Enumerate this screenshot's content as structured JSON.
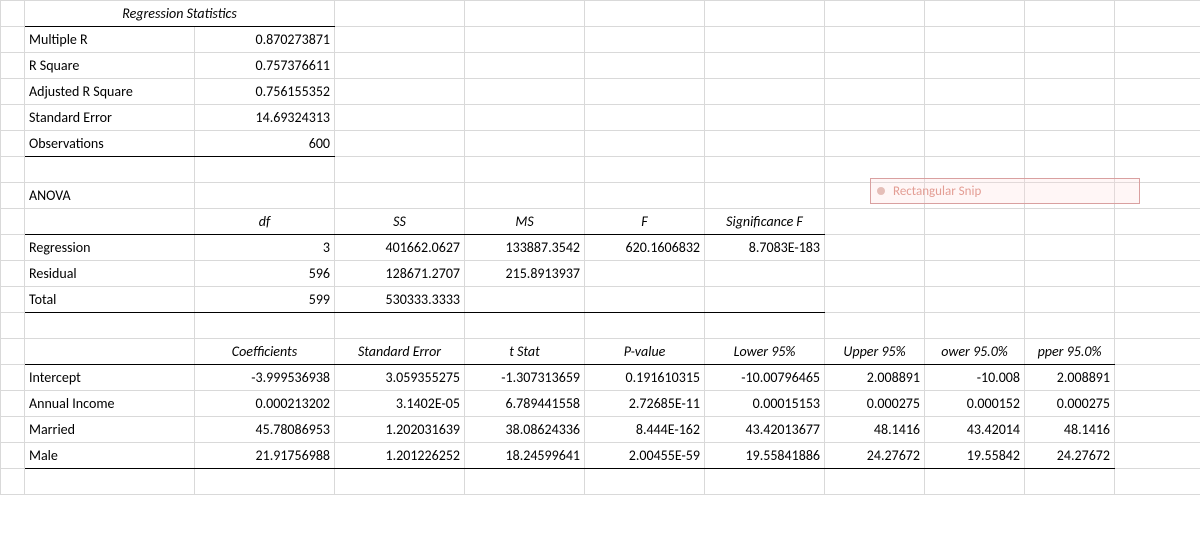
{
  "snip_label": "Rectangular Snip",
  "regstats": {
    "title": "Regression Statistics",
    "rows": [
      {
        "label": "Multiple R",
        "value": "0.870273871"
      },
      {
        "label": "R Square",
        "value": "0.757376611"
      },
      {
        "label": "Adjusted R Square",
        "value": "0.756155352"
      },
      {
        "label": "Standard Error",
        "value": "14.69324313"
      },
      {
        "label": "Observations",
        "value": "600"
      }
    ]
  },
  "anova": {
    "title": "ANOVA",
    "headers": {
      "df": "df",
      "ss": "SS",
      "ms": "MS",
      "f": "F",
      "sigf": "Significance F"
    },
    "rows": [
      {
        "label": "Regression",
        "df": "3",
        "ss": "401662.0627",
        "ms": "133887.3542",
        "f": "620.1606832",
        "sigf": "8.7083E-183"
      },
      {
        "label": "Residual",
        "df": "596",
        "ss": "128671.2707",
        "ms": "215.8913937",
        "f": "",
        "sigf": ""
      },
      {
        "label": "Total",
        "df": "599",
        "ss": "530333.3333",
        "ms": "",
        "f": "",
        "sigf": ""
      }
    ]
  },
  "coef": {
    "headers": {
      "coef": "Coefficients",
      "se": "Standard Error",
      "t": "t Stat",
      "p": "P-value",
      "l95": "Lower 95%",
      "u95": "Upper 95%",
      "l950": "ower 95.0%",
      "u950": "pper 95.0%"
    },
    "rows": [
      {
        "label": "Intercept",
        "coef": "-3.999536938",
        "se": "3.059355275",
        "t": "-1.307313659",
        "p": "0.191610315",
        "l95": "-10.00796465",
        "u95": "2.008891",
        "l950": "-10.008",
        "u950": "2.008891"
      },
      {
        "label": "Annual Income",
        "coef": "0.000213202",
        "se": "3.1402E-05",
        "t": "6.789441558",
        "p": "2.72685E-11",
        "l95": "0.00015153",
        "u95": "0.000275",
        "l950": "0.000152",
        "u950": "0.000275"
      },
      {
        "label": "Married",
        "coef": "45.78086953",
        "se": "1.202031639",
        "t": "38.08624336",
        "p": "8.444E-162",
        "l95": "43.42013677",
        "u95": "48.1416",
        "l950": "43.42014",
        "u950": "48.1416"
      },
      {
        "label": "Male",
        "coef": "21.91756988",
        "se": "1.201226252",
        "t": "18.24599641",
        "p": "2.00455E-59",
        "l95": "19.55841886",
        "u95": "24.27672",
        "l950": "19.55842",
        "u950": "24.27672"
      }
    ]
  },
  "chart_data": {
    "type": "table",
    "title": "Excel Regression Output",
    "regression_statistics": {
      "Multiple R": 0.870273871,
      "R Square": 0.757376611,
      "Adjusted R Square": 0.756155352,
      "Standard Error": 14.69324313,
      "Observations": 600
    },
    "anova": [
      {
        "source": "Regression",
        "df": 3,
        "SS": 401662.0627,
        "MS": 133887.3542,
        "F": 620.1606832,
        "Significance F": 8.7083e-183
      },
      {
        "source": "Residual",
        "df": 596,
        "SS": 128671.2707,
        "MS": 215.8913937
      },
      {
        "source": "Total",
        "df": 599,
        "SS": 530333.3333
      }
    ],
    "coefficients": [
      {
        "term": "Intercept",
        "coef": -3.999536938,
        "se": 3.059355275,
        "t": -1.307313659,
        "p": 0.191610315,
        "lower95": -10.00796465,
        "upper95": 2.008891,
        "lower95_0": -10.008,
        "upper95_0": 2.008891
      },
      {
        "term": "Annual Income",
        "coef": 0.000213202,
        "se": 3.1402e-05,
        "t": 6.789441558,
        "p": 2.72685e-11,
        "lower95": 0.00015153,
        "upper95": 0.000275,
        "lower95_0": 0.000152,
        "upper95_0": 0.000275
      },
      {
        "term": "Married",
        "coef": 45.78086953,
        "se": 1.202031639,
        "t": 38.08624336,
        "p": 8.444e-162,
        "lower95": 43.42013677,
        "upper95": 48.1416,
        "lower95_0": 43.42014,
        "upper95_0": 48.1416
      },
      {
        "term": "Male",
        "coef": 21.91756988,
        "se": 1.201226252,
        "t": 18.24599641,
        "p": 2.00455e-59,
        "lower95": 19.55841886,
        "upper95": 24.27672,
        "lower95_0": 19.55842,
        "upper95_0": 24.27672
      }
    ]
  }
}
